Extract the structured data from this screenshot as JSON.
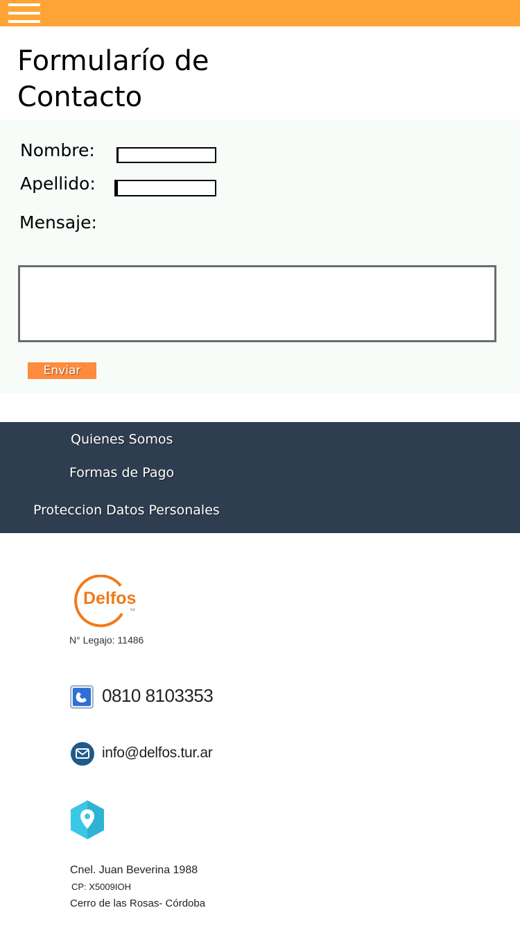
{
  "header": {
    "menu_icon": "hamburger-menu-icon",
    "background": "#ffa537"
  },
  "page": {
    "title": "Formularío de Contacto"
  },
  "form": {
    "nombre_label": "Nombre:",
    "nombre_value": "",
    "apellido_label": "Apellido:",
    "apellido_value": "",
    "mensaje_label": "Mensaje:",
    "mensaje_value": "",
    "submit_label": "Enviar",
    "submit_color": "#ff8b3d"
  },
  "footer_nav": {
    "background": "#2e3d4f",
    "links": [
      {
        "label": "Quienes Somos"
      },
      {
        "label": "Formas de Pago"
      },
      {
        "label": "Proteccion Datos Personales"
      }
    ]
  },
  "company": {
    "logo_text": "Delfos",
    "logo_subtext": "tur",
    "logo_color": "#f07a1a",
    "legajo": "N° Legajo: 11486",
    "phone_icon": "telephone-icon",
    "phone": "0810 8103353",
    "email_icon": "envelope-icon",
    "email": "info@delfos.tur.ar",
    "location_icon": "map-pin-icon",
    "address_line1": "Cnel. Juan Beverina 1988",
    "address_line2": "CP: X5009IOH",
    "address_line3": "Cerro de las Rosas- Córdoba"
  }
}
